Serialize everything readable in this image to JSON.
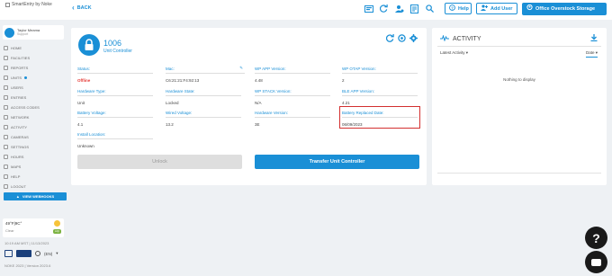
{
  "app": {
    "logo_alt": "SmartEntry by Noke"
  },
  "topbar": {
    "back_label": "BACK",
    "help_label": "Help",
    "add_user_label": "Add User",
    "facility_label": "Office Overstock Storage"
  },
  "user": {
    "name": "Taylor Meama",
    "role": "Support"
  },
  "sidebar": {
    "items": [
      {
        "label": "HOME",
        "icon": "home-icon"
      },
      {
        "label": "FACILITIES",
        "icon": "building-icon"
      },
      {
        "label": "REPORTS",
        "icon": "chart-icon"
      },
      {
        "label": "UNITS",
        "icon": "lock-icon",
        "active_dot": true
      },
      {
        "label": "USERS",
        "icon": "users-icon"
      },
      {
        "label": "ENTRIES",
        "icon": "entry-icon"
      },
      {
        "label": "ACCESS CODES",
        "icon": "key-icon"
      },
      {
        "label": "NETWORK",
        "icon": "network-icon"
      },
      {
        "label": "ACTIVITY",
        "icon": "activity-icon"
      },
      {
        "label": "CAMERAS",
        "icon": "camera-icon"
      },
      {
        "label": "SETTINGS",
        "icon": "gear-icon"
      },
      {
        "label": "HOURS",
        "icon": "clock-icon"
      },
      {
        "label": "MAPS",
        "icon": "map-icon"
      },
      {
        "label": "HELP",
        "icon": "help-icon"
      },
      {
        "label": "LOGOUT",
        "icon": "logout-icon"
      }
    ],
    "webhooks_label": "VIEW WEBHOOKS"
  },
  "weather": {
    "temp": "49°F|9C°",
    "condition": "Clear",
    "badge": "AQI"
  },
  "datetime": "10:19 AM MST | 11/13/2023",
  "language": "(EN)",
  "version": "NOKE 2023 | Version 2023.6",
  "unit": {
    "number": "1006",
    "type": "Unit Controller",
    "fields": [
      {
        "label": "Status:",
        "value": "Offline",
        "status": "error"
      },
      {
        "label": "Mac:",
        "value": "C6:21:21:F4:92:13"
      },
      {
        "label": "WP APP Version:",
        "value": "4.48"
      },
      {
        "label": "WP OTAP Version:",
        "value": "2"
      },
      {
        "label": "Hardware Type:",
        "value": "Unit"
      },
      {
        "label": "Hardware State:",
        "value": "Locked"
      },
      {
        "label": "WP STACK Version:",
        "value": "N/A"
      },
      {
        "label": "BLE APP Version:",
        "value": "4.21"
      },
      {
        "label": "Battery Voltage:",
        "value": "4.1"
      },
      {
        "label": "Wired Voltage:",
        "value": "13.2"
      },
      {
        "label": "Hardware Version:",
        "value": "3E"
      },
      {
        "label": "Battery Replaced Date:",
        "value": "06/09/2023"
      },
      {
        "label": "Install Location:",
        "value": "Unknown"
      }
    ],
    "unlock_label": "Unlock",
    "transfer_label": "Transfer Unit Controller"
  },
  "activity": {
    "title": "ACTIVITY",
    "filter": "Latest Activity",
    "sort": "Date",
    "empty": "Nothing to display"
  },
  "colors": {
    "accent": "#1a8fd6",
    "error": "#e53935",
    "highlight": "#d32f2f"
  }
}
